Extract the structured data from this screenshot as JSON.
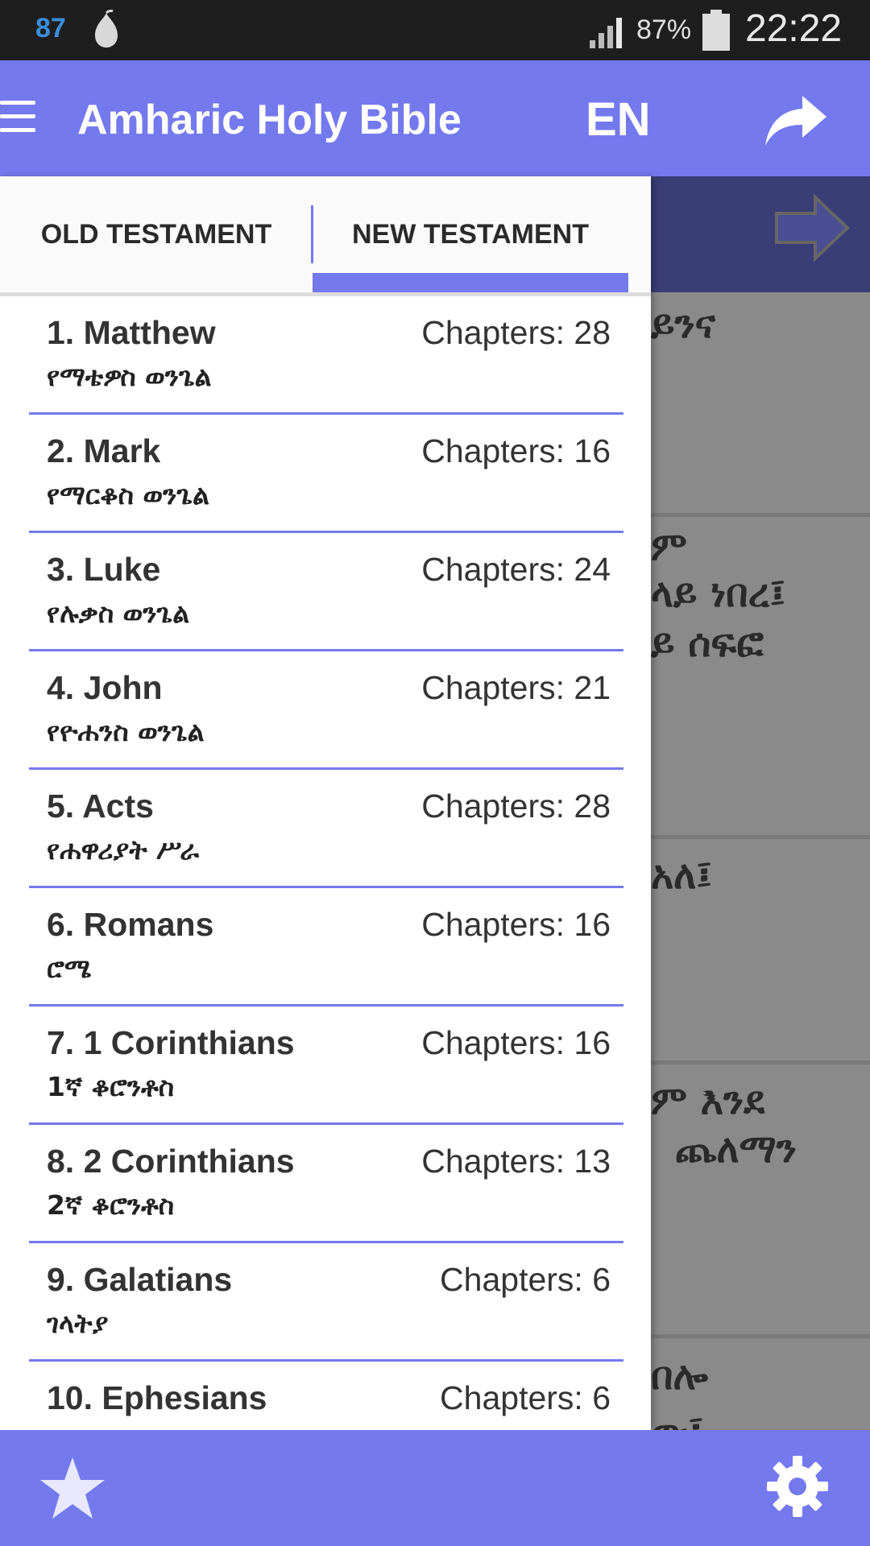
{
  "status_bar": {
    "notification_count": "87",
    "battery_percent": "87%",
    "time": "22:22"
  },
  "app_bar": {
    "title": "Amharic Holy Bible",
    "language": "EN",
    "icons": [
      "menu-icon",
      "share-icon"
    ]
  },
  "tabs": {
    "old": "OLD TESTAMENT",
    "new": "NEW TESTAMENT",
    "selected": "new"
  },
  "books": [
    {
      "number": "1.",
      "name": "Matthew",
      "chapters": "Chapters: 28",
      "amharic": "የማቴዎስ ወንጌል"
    },
    {
      "number": "2.",
      "name": "Mark",
      "chapters": "Chapters: 16",
      "amharic": "የማርቆስ ወንጌል"
    },
    {
      "number": "3.",
      "name": "Luke",
      "chapters": "Chapters: 24",
      "amharic": "የሉቃስ ወንጌል"
    },
    {
      "number": "4.",
      "name": "John",
      "chapters": "Chapters: 21",
      "amharic": "የዮሐንስ ወንጌል"
    },
    {
      "number": "5.",
      "name": "Acts",
      "chapters": "Chapters: 28",
      "amharic": "የሐዋሪያት ሥራ"
    },
    {
      "number": "6.",
      "name": "Romans",
      "chapters": "Chapters: 16",
      "amharic": "ሮሜ"
    },
    {
      "number": "7.",
      "name": "1 Corinthians",
      "chapters": "Chapters: 16",
      "amharic": "1ኛ ቆሮንቶስ"
    },
    {
      "number": "8.",
      "name": "2 Corinthians",
      "chapters": "Chapters: 13",
      "amharic": "2ኛ ቆሮንቶስ"
    },
    {
      "number": "9.",
      "name": "Galatians",
      "chapters": "Chapters: 6",
      "amharic": "ገላትያ"
    },
    {
      "number": "10.",
      "name": "Ephesians",
      "chapters": "Chapters: 6",
      "amharic": ""
    }
  ],
  "background_text": {
    "frag1": "ይንና",
    "frag2": "ም",
    "frag3": "ላይ ነበረ፤",
    "frag4": "ይ ሰፍፎ",
    "frag5": "አለ፤",
    "frag6": "ም እንደ",
    "frag7": "ጨለማን",
    "frag8": "በሎ",
    "frag9": "ው፤"
  },
  "bottom_bar": {
    "icons": [
      "star-icon",
      "gear-icon"
    ]
  },
  "colors": {
    "accent": "#7479ee",
    "status_bar": "#1e1e1e",
    "overlay": "#8a8a8a"
  }
}
